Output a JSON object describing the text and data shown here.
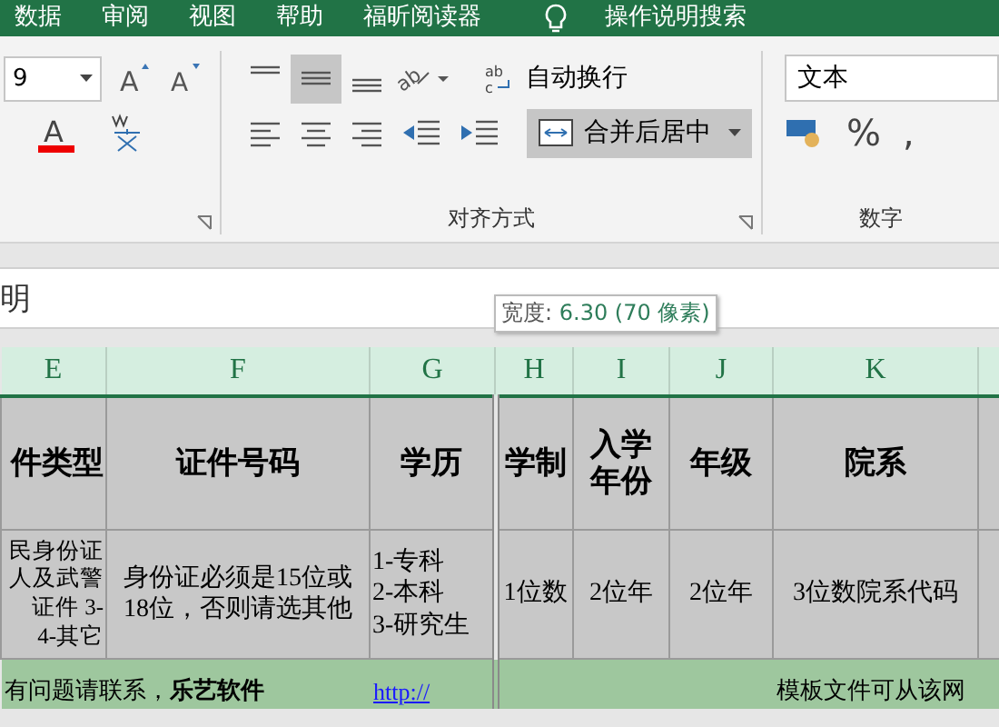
{
  "menu_tabs": [
    {
      "label": "数据"
    },
    {
      "label": "审阅"
    },
    {
      "label": "视图"
    },
    {
      "label": "帮助"
    },
    {
      "label": "福昕阅读器"
    }
  ],
  "search": {
    "label": "操作说明搜索"
  },
  "ribbon": {
    "font": {
      "size": "9",
      "grow_glyph": "A",
      "shrink_glyph": "A",
      "color_glyph": "A"
    },
    "alignment": {
      "label": "对齐方式",
      "orientation_glyph": "ab",
      "vertical": [
        {
          "kind": "top",
          "selected": false
        },
        {
          "kind": "middle",
          "selected": true
        },
        {
          "kind": "bottom",
          "selected": false
        }
      ],
      "wrap_text": {
        "label": "自动换行",
        "glyph_top": "ab",
        "glyph_bottom": "c",
        "selected": false
      },
      "merge": {
        "label": "合并后居中",
        "selected": true
      }
    },
    "number": {
      "label": "数字",
      "format": "文本",
      "percent": "%",
      "comma": ","
    }
  },
  "formula_bar": {
    "value": "明"
  },
  "tooltip": {
    "label": "宽度:",
    "value": "6.30 (70 像素)"
  },
  "columns": [
    "E",
    "F",
    "G",
    "H",
    "I",
    "J",
    "K"
  ],
  "header_row": [
    "件类型",
    "证件号码",
    "学历",
    "学制",
    "入学年份",
    "年级",
    "院系"
  ],
  "data_row": [
    [
      "民身份证",
      "人及武警",
      "证件 3-",
      "4-其它"
    ],
    [
      "身份证必须是15位或",
      "18位，否则请选其他"
    ],
    [
      "1-专科",
      "2-本科",
      "3-研究生"
    ],
    [
      "1位数"
    ],
    [
      "2位年"
    ],
    [
      "2位年"
    ],
    [
      "3位数院系代码"
    ]
  ],
  "footer_row": {
    "note": "有问题请联系，**乐艺软件**",
    "link": "http://",
    "tail": "模板文件可从该网"
  }
}
